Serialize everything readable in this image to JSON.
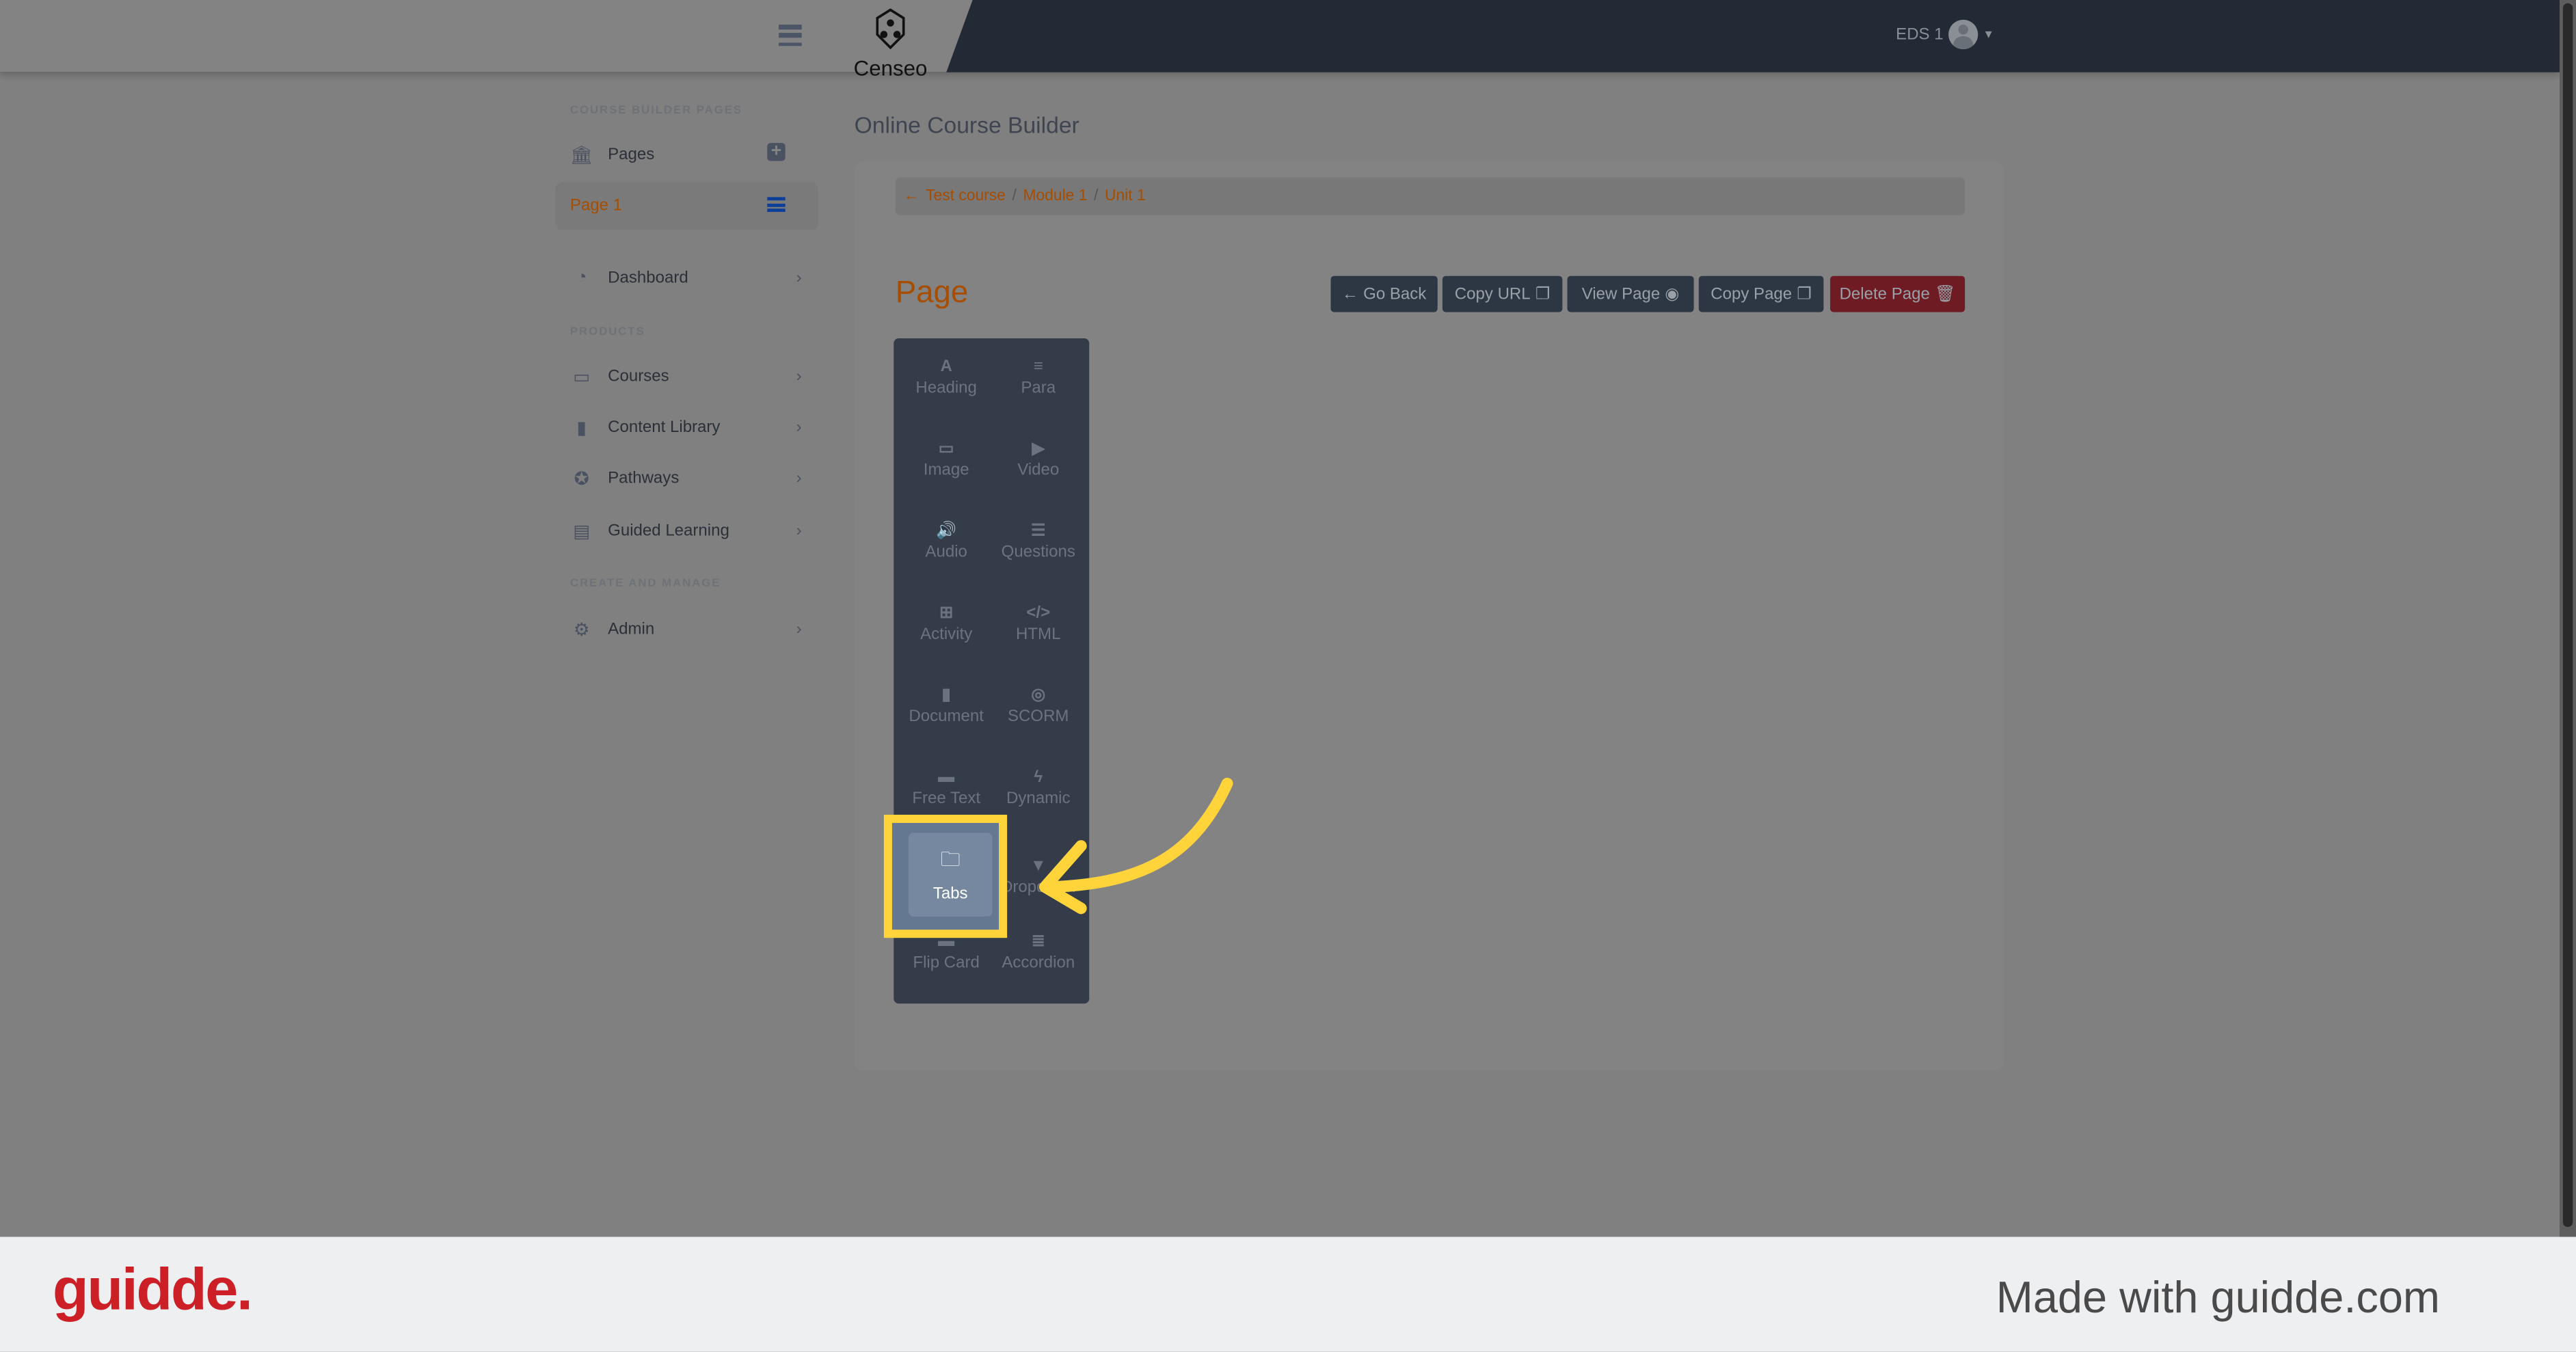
{
  "header": {
    "logo_text": "Censeo",
    "user_label": "EDS 1"
  },
  "sidebar": {
    "section_builder": "COURSE BUILDER PAGES",
    "pages_label": "Pages",
    "current_page": "Page 1",
    "dashboard": "Dashboard",
    "section_products": "PRODUCTS",
    "products": [
      {
        "label": "Courses",
        "icon": "chalkboard-teacher-icon"
      },
      {
        "label": "Content Library",
        "icon": "book-icon"
      },
      {
        "label": "Pathways",
        "icon": "award-icon"
      },
      {
        "label": "Guided Learning",
        "icon": "clipboard-list-icon"
      }
    ],
    "section_manage": "CREATE AND MANAGE",
    "admin": "Admin"
  },
  "main": {
    "title": "Online Course Builder",
    "breadcrumb": [
      "Test course",
      "Module 1",
      "Unit 1"
    ],
    "page_heading": "Page",
    "buttons": {
      "go_back": "Go Back",
      "copy_url": "Copy URL",
      "view_page": "View Page",
      "copy_page": "Copy Page",
      "delete_page": "Delete Page"
    },
    "palette": [
      {
        "label": "Heading",
        "glyph": "A"
      },
      {
        "label": "Para",
        "glyph": "≡"
      },
      {
        "label": "Image",
        "glyph": "▭"
      },
      {
        "label": "Video",
        "glyph": "▶"
      },
      {
        "label": "Audio",
        "glyph": "🔊"
      },
      {
        "label": "Questions",
        "glyph": "☰"
      },
      {
        "label": "Activity",
        "glyph": "⊞"
      },
      {
        "label": "HTML",
        "glyph": "</>"
      },
      {
        "label": "Document",
        "glyph": "▮"
      },
      {
        "label": "SCORM",
        "glyph": "◎"
      },
      {
        "label": "Free Text",
        "glyph": "▬"
      },
      {
        "label": "Dynamic",
        "glyph": "ϟ"
      },
      {
        "label": "Tabs",
        "glyph": "🗀"
      },
      {
        "label": "Dropdown",
        "glyph": "▼"
      },
      {
        "label": "Flip Card",
        "glyph": "▬"
      },
      {
        "label": "Accordion",
        "glyph": "≣"
      }
    ],
    "highlighted_item": "Tabs"
  },
  "colors": {
    "accent": "#a64d00",
    "highlight": "#ffd43b",
    "delete": "#6e1b23",
    "button": "#2d3744"
  },
  "footer": {
    "brand": "guidde.",
    "tagline": "Made with guidde.com"
  }
}
